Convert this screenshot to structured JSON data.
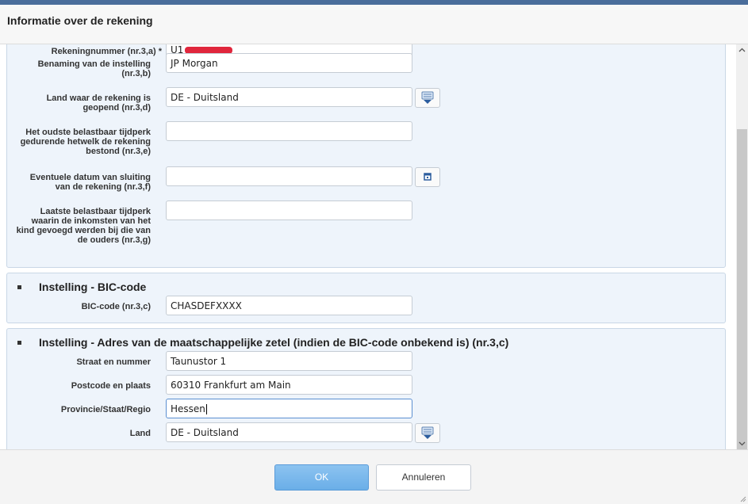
{
  "dialog": {
    "title": "Informatie over de rekening"
  },
  "account": {
    "number_label": "Rekeningnummer (nr.3,a) *",
    "number_prefix": "U1",
    "institution_label_1": "Benaming van de instelling",
    "institution_label_2": "(nr.3,b)",
    "institution_value": "JP Morgan",
    "country_label_1": "Land waar de rekening is",
    "country_label_2": "geopend (nr.3,d)",
    "country_value": "DE - Duitsland",
    "oldest_label_1": "Het oudste belastbaar tijdperk",
    "oldest_label_2": "gedurende hetwelk de rekening",
    "oldest_label_3": "bestond (nr.3,e)",
    "oldest_value": "",
    "closing_label_1": "Eventuele datum van sluiting",
    "closing_label_2": "van de rekening (nr.3,f)",
    "closing_value": "",
    "last_label_1": "Laatste belastbaar tijdperk",
    "last_label_2": "waarin de inkomsten van het",
    "last_label_3": "kind gevoegd werden bij die van",
    "last_label_4": "de ouders (nr.3,g)",
    "last_value": ""
  },
  "bic_section": {
    "title": "Instelling - BIC-code",
    "bic_label": "BIC-code (nr.3,c)",
    "bic_value": "CHASDEFXXXX"
  },
  "address_section": {
    "title": "Instelling - Adres van de maatschappelijke zetel (indien de BIC-code onbekend is) (nr.3,c)",
    "street_label": "Straat en nummer",
    "street_value": "Taunustor 1",
    "postal_label": "Postcode en plaats",
    "postal_value": "60310 Frankfurt am Main",
    "province_label": "Provincie/Staat/Regio",
    "province_value": "Hessen",
    "country_label": "Land",
    "country_value": "DE - Duitsland"
  },
  "footer": {
    "ok_label": "OK",
    "cancel_label": "Annuleren"
  },
  "colors": {
    "accent": "#6aaee8",
    "panel": "#eef4fb",
    "header": "#4a6d9b"
  }
}
